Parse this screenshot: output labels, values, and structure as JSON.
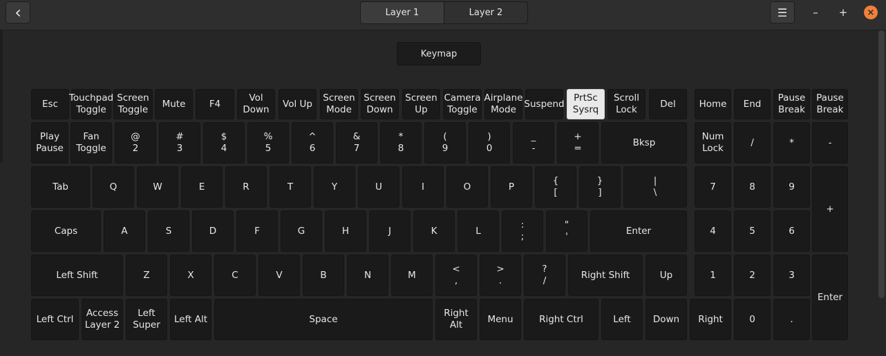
{
  "header": {
    "tabs": [
      {
        "label": "Layer 1",
        "active": true
      },
      {
        "label": "Layer 2",
        "active": false
      }
    ],
    "icons": {
      "back": "‹",
      "menu": "☰",
      "minimize": "–",
      "maximize": "+",
      "close": "×"
    }
  },
  "main": {
    "keymap_label": "Keymap",
    "selected_key": "PrtSc\nSysrq",
    "keys": [
      "Esc",
      "Touchpad\nToggle",
      "Screen\nToggle",
      "Mute",
      "F4",
      "Vol\nDown",
      "Vol Up",
      "Screen\nMode",
      "Screen\nDown",
      "Screen\nUp",
      "Camera\nToggle",
      "Airplane\nMode",
      "Suspend",
      "PrtSc\nSysrq",
      "Scroll\nLock",
      "Del",
      "Home",
      "End",
      "Pause\nBreak",
      "Pause\nBreak",
      "Play\nPause",
      "Fan\nToggle",
      "@\n2",
      "#\n3",
      "$\n4",
      "%\n5",
      "^\n6",
      "&\n7",
      "*\n8",
      "(\n9",
      ")\n0",
      "_\n-",
      "+\n=",
      "Bksp",
      "Num\nLock",
      "/",
      "*",
      "-",
      "Tab",
      "Q",
      "W",
      "E",
      "R",
      "T",
      "Y",
      "U",
      "I",
      "O",
      "P",
      "{\n[",
      "}\n]",
      "|\n\\",
      "7",
      "8",
      "9",
      "+",
      "Caps",
      "A",
      "S",
      "D",
      "F",
      "G",
      "H",
      "J",
      "K",
      "L",
      ":\n;",
      "\"\n'",
      "Enter",
      "4",
      "5",
      "6",
      "Left Shift",
      "Z",
      "X",
      "C",
      "V",
      "B",
      "N",
      "M",
      "<\n,",
      ">\n.",
      "?\n/",
      "Right Shift",
      "Up",
      "1",
      "2",
      "3",
      "Enter",
      "Left Ctrl",
      "Access\nLayer 2",
      "Left\nSuper",
      "Left Alt",
      "Space",
      "Right Alt",
      "Menu",
      "Right Ctrl",
      "Left",
      "Down",
      "Right",
      "0",
      "."
    ]
  }
}
